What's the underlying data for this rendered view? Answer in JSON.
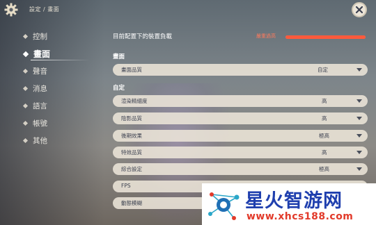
{
  "header": {
    "breadcrumb": "設定 / 畫面"
  },
  "sidebar": {
    "items": [
      {
        "label": "控制"
      },
      {
        "label": "畫面",
        "active": true
      },
      {
        "label": "聲音"
      },
      {
        "label": "消息"
      },
      {
        "label": "語言"
      },
      {
        "label": "帳號"
      },
      {
        "label": "其他"
      }
    ]
  },
  "load": {
    "label": "目前配置下的裝置負載",
    "status": "嚴重過高",
    "level": 1.0,
    "color": "#ff5a3c"
  },
  "sections": {
    "display_title": "畫面",
    "custom_title": "自定"
  },
  "settings": {
    "quality": {
      "label": "畫面品質",
      "value": "自定"
    },
    "render_precision": {
      "label": "渲染精細度",
      "value": "高"
    },
    "shadow_quality": {
      "label": "陰影品質",
      "value": "高"
    },
    "post_processing": {
      "label": "後期效果",
      "value": "極高"
    },
    "effects_quality": {
      "label": "特效品質",
      "value": "高"
    },
    "overall": {
      "label": "綜合設定",
      "value": "極高"
    },
    "fps": {
      "label": "FPS",
      "value": ""
    },
    "motion_blur": {
      "label": "動態模糊",
      "value": ""
    }
  },
  "watermark": {
    "title": "星火智游网",
    "url": "www.xhcs188.com"
  }
}
